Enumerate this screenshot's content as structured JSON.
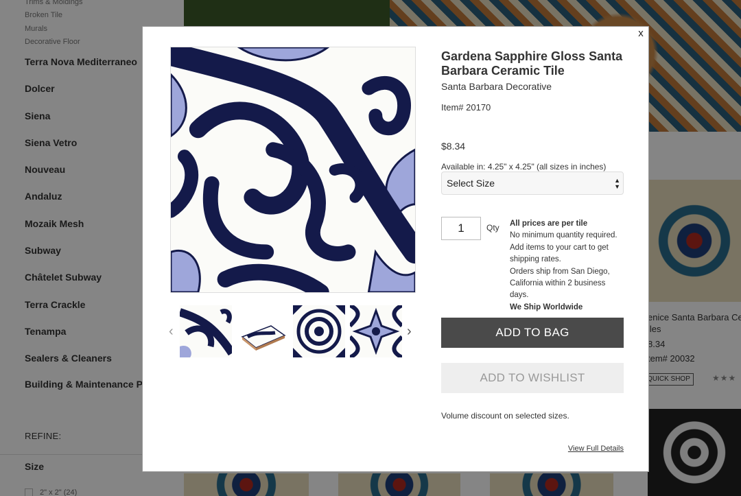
{
  "sidebar": {
    "sub_links": [
      "Trims & Moldings",
      "Broken Tile",
      "Murals",
      "Decorative Floor"
    ],
    "categories": [
      "Terra Nova Mediterraneo",
      "Dolcer",
      "Siena",
      "Siena Vetro",
      "Nouveau",
      "Andaluz",
      "Mozaik Mesh",
      "Subway",
      "Châtelet Subway",
      "Terra Crackle",
      "Tenampa",
      "Sealers & Cleaners",
      "Building & Maintenance Products"
    ],
    "refine_label": "REFINE:",
    "size_heading": "Size",
    "size_option": "2\" x 2\"",
    "size_option_count": "(24)"
  },
  "background_card": {
    "name_line1": "enice Santa Barbara Cer",
    "name_line2": "iles",
    "price": "8.34",
    "item": "tem# 20032",
    "quick_shop": "QUICK SHOP",
    "stars": "★★★"
  },
  "modal": {
    "close_label": "x",
    "title": "Gardena Sapphire Gloss Santa Barbara Ceramic Tile",
    "brand": "Santa Barbara Decorative",
    "item_number": "Item# 20170",
    "price": "$8.34",
    "available": "Available in: 4.25\" x 4.25\" (all sizes in inches)",
    "size_select": {
      "selected": "Select Size"
    },
    "quantity": {
      "value": "1",
      "label": "Qty"
    },
    "notes": {
      "bold_line": "All prices are per tile",
      "lines": [
        "No minimum quantity required.",
        "Add items to your cart to get shipping rates.",
        "Orders ship from San Diego, California within 2 business days."
      ],
      "ship_worldwide": "We Ship Worldwide"
    },
    "add_to_bag": "ADD TO BAG",
    "add_to_wishlist": "ADD TO WISHLIST",
    "volume_discount": "Volume discount on selected sizes.",
    "view_full_details": "View Full Details",
    "thumb_prev_icon": "chevron-left-icon",
    "thumb_next_icon": "chevron-right-icon",
    "colors": {
      "navy": "#141a4a",
      "periwinkle": "#9ea6da",
      "tile_white": "#fbfbf8",
      "button_dark": "#4a4a4a"
    }
  }
}
